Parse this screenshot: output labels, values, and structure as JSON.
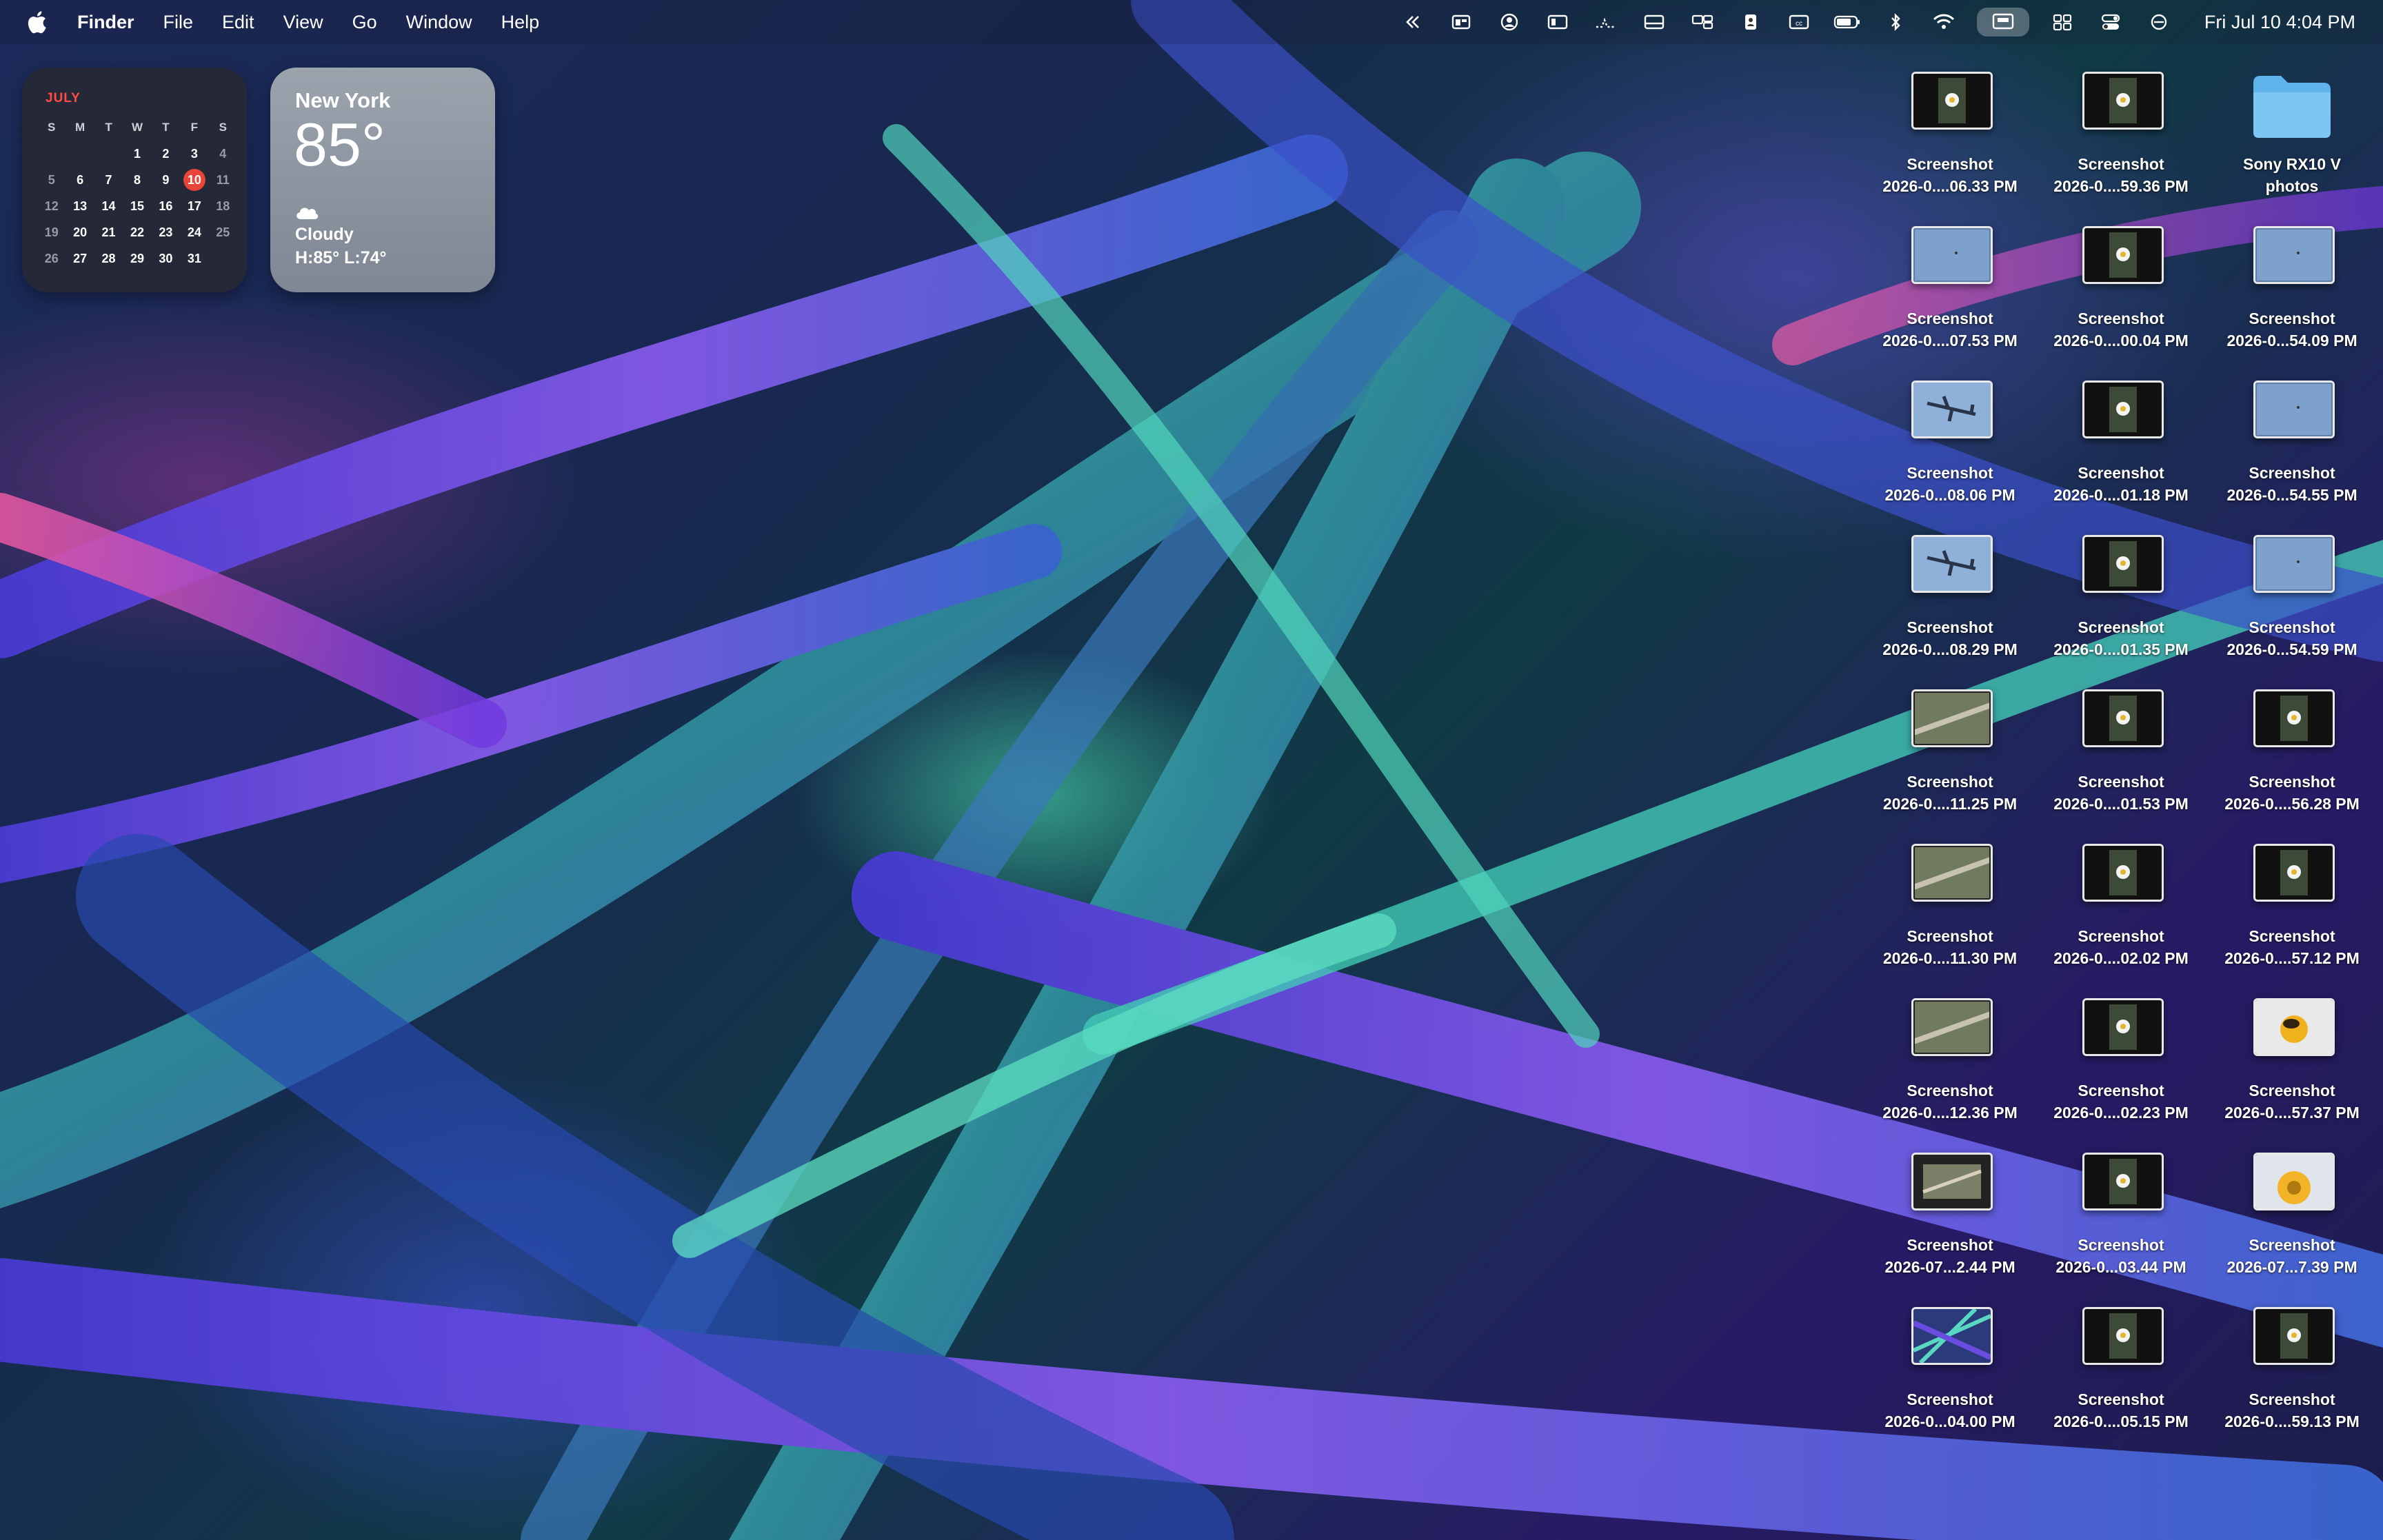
{
  "menubar": {
    "app_name": "Finder",
    "menus": [
      "File",
      "Edit",
      "View",
      "Go",
      "Window",
      "Help"
    ],
    "clock": "Fri Jul 10  4:04 PM",
    "status_icons": [
      "chevrons-left-icon",
      "window-icon",
      "person-circle-icon",
      "sidebar-icon",
      "activity-icon",
      "card-icon",
      "screens-icon",
      "contact-icon",
      "cc-icon",
      "battery-icon",
      "bluetooth-icon",
      "wifi-icon",
      "screen-mirroring-icon",
      "stage-manager-icon",
      "control-center-icon",
      "focus-icon"
    ]
  },
  "calendar": {
    "month": "JULY",
    "days_of_week": [
      "S",
      "M",
      "T",
      "W",
      "T",
      "F",
      "S"
    ],
    "weeks": [
      [
        "",
        "",
        "",
        "1",
        "2",
        "3",
        "4"
      ],
      [
        "5",
        "6",
        "7",
        "8",
        "9",
        "10",
        "11"
      ],
      [
        "12",
        "13",
        "14",
        "15",
        "16",
        "17",
        "18"
      ],
      [
        "19",
        "20",
        "21",
        "22",
        "23",
        "24",
        "25"
      ],
      [
        "26",
        "27",
        "28",
        "29",
        "30",
        "31",
        ""
      ]
    ],
    "today": "10"
  },
  "weather": {
    "city": "New York",
    "temperature": "85°",
    "condition": "Cloudy",
    "high_low": "H:85° L:74°",
    "icon": "cloud-icon"
  },
  "desktop_items": [
    {
      "line1": "Screenshot",
      "line2": "2026-0....06.33 PM",
      "thumb": "flower"
    },
    {
      "line1": "Screenshot",
      "line2": "2026-0....59.36 PM",
      "thumb": "flower"
    },
    {
      "line1": "Sony RX10 V",
      "line2": "photos",
      "thumb": "folder"
    },
    {
      "line1": "Screenshot",
      "line2": "2026-0....07.53 PM",
      "thumb": "sky"
    },
    {
      "line1": "Screenshot",
      "line2": "2026-0....00.04 PM",
      "thumb": "flower"
    },
    {
      "line1": "Screenshot",
      "line2": "2026-0...54.09 PM",
      "thumb": "sky"
    },
    {
      "line1": "Screenshot",
      "line2": "2026-0...08.06 PM",
      "thumb": "plane"
    },
    {
      "line1": "Screenshot",
      "line2": "2026-0....01.18 PM",
      "thumb": "flower"
    },
    {
      "line1": "Screenshot",
      "line2": "2026-0...54.55 PM",
      "thumb": "sky"
    },
    {
      "line1": "Screenshot",
      "line2": "2026-0....08.29 PM",
      "thumb": "plane"
    },
    {
      "line1": "Screenshot",
      "line2": "2026-0....01.35 PM",
      "thumb": "flower"
    },
    {
      "line1": "Screenshot",
      "line2": "2026-0...54.59 PM",
      "thumb": "sky"
    },
    {
      "line1": "Screenshot",
      "line2": "2026-0....11.25 PM",
      "thumb": "branch"
    },
    {
      "line1": "Screenshot",
      "line2": "2026-0....01.53 PM",
      "thumb": "flower"
    },
    {
      "line1": "Screenshot",
      "line2": "2026-0....56.28 PM",
      "thumb": "flower"
    },
    {
      "line1": "Screenshot",
      "line2": "2026-0....11.30 PM",
      "thumb": "branch"
    },
    {
      "line1": "Screenshot",
      "line2": "2026-0....02.02 PM",
      "thumb": "flower"
    },
    {
      "line1": "Screenshot",
      "line2": "2026-0....57.12 PM",
      "thumb": "flower"
    },
    {
      "line1": "Screenshot",
      "line2": "2026-0....12.36 PM",
      "thumb": "branch"
    },
    {
      "line1": "Screenshot",
      "line2": "2026-0....02.23 PM",
      "thumb": "flower"
    },
    {
      "line1": "Screenshot",
      "line2": "2026-0....57.37 PM",
      "thumb": "bee"
    },
    {
      "line1": "Screenshot",
      "line2": "2026-07...2.44 PM",
      "thumb": "window"
    },
    {
      "line1": "Screenshot",
      "line2": "2026-0...03.44 PM",
      "thumb": "flower"
    },
    {
      "line1": "Screenshot",
      "line2": "2026-07...7.39 PM",
      "thumb": "yellow-flower"
    },
    {
      "line1": "Screenshot",
      "line2": "2026-0...04.00 PM",
      "thumb": "wallpaper"
    },
    {
      "line1": "Screenshot",
      "line2": "2026-0....05.15 PM",
      "thumb": "flower"
    },
    {
      "line1": "Screenshot",
      "line2": "2026-0....59.13 PM",
      "thumb": "flower"
    }
  ]
}
